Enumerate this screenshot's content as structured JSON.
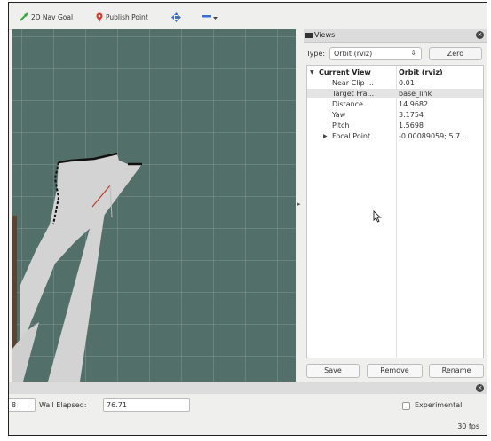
{
  "toolbar": {
    "items": [
      {
        "label": "2D Nav Goal",
        "icon": "nav-goal-arrow-icon"
      },
      {
        "label": "Publish Point",
        "icon": "map-pin-icon"
      },
      {
        "label": "",
        "icon": "move-camera-icon"
      },
      {
        "label": "",
        "icon": "minus-dropdown-icon"
      }
    ]
  },
  "views_panel": {
    "title": "Views",
    "type_label": "Type:",
    "type_value": "Orbit (rviz)",
    "zero_label": "Zero",
    "properties": {
      "header": {
        "name": "Current View",
        "value": "Orbit (rviz)"
      },
      "rows": [
        {
          "name": "Near Clip ...",
          "value": "0.01"
        },
        {
          "name": "Target Fra...",
          "value": "base_link"
        },
        {
          "name": "Distance",
          "value": "14.9682"
        },
        {
          "name": "Yaw",
          "value": "3.1754"
        },
        {
          "name": "Pitch",
          "value": "1.5698"
        },
        {
          "name": "Focal Point",
          "value": "-0.00089059; 5.7..."
        }
      ]
    },
    "buttons": {
      "save": "Save",
      "remove": "Remove",
      "rename": "Rename"
    }
  },
  "time_panel": {
    "ros_elapsed_partial": "8",
    "wall_elapsed_label": "Wall Elapsed:",
    "wall_elapsed_value": "76.71",
    "experimental_label": "Experimental",
    "experimental_checked": false,
    "fps": "30 fps"
  },
  "colors": {
    "grid_background": "#536f6a",
    "nav_goal_icon": "#3aa63a",
    "publish_point_icon": "#d23a2a",
    "move_icon": "#3a6fd2"
  }
}
